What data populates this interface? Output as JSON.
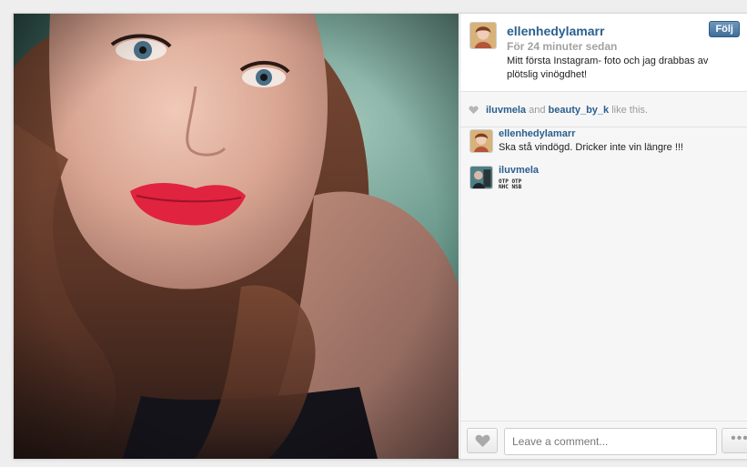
{
  "post": {
    "username": "ellenhedylamarr",
    "time": "För 24 minuter sedan",
    "caption": "Mitt första Instagram- foto och jag drabbas av plötslig vinögdhet!",
    "follow_label": "Följ"
  },
  "likes": {
    "user1": "iluvmela",
    "and": "and",
    "user2": "beauty_by_k",
    "suffix": "like this."
  },
  "comments": [
    {
      "user": "ellenhedylamarr",
      "text": "Ska stå vindögd. Dricker inte vin längre !!!"
    },
    {
      "user": "iluvmela",
      "text": "OTP OTP\nNHC NSB"
    }
  ],
  "footer": {
    "comment_placeholder": "Leave a comment...",
    "more_label": "•••"
  },
  "colors": {
    "link": "#2a5f8f",
    "follow_button": "#3f6d98",
    "lips": "#e0233f"
  },
  "icons": {
    "like": "heart-icon",
    "more": "more-dots-icon"
  }
}
